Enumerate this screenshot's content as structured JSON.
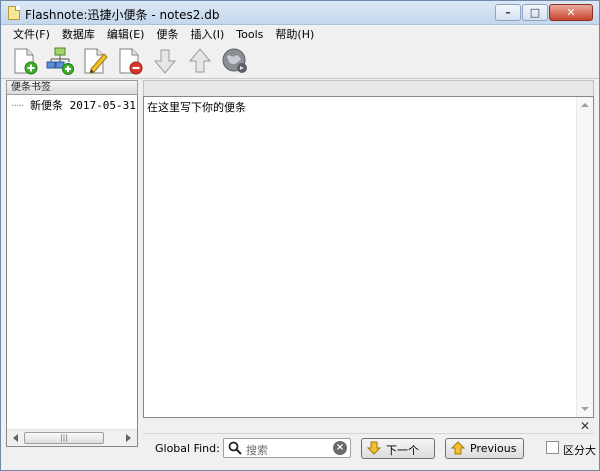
{
  "window": {
    "title": "Flashnote:迅捷小便条 - notes2.db",
    "caption": {
      "minimize": "–",
      "maximize": "□",
      "close": "✕"
    }
  },
  "menu": {
    "items": [
      {
        "label": "文件(F)"
      },
      {
        "label": "数据库"
      },
      {
        "label": "编辑(E)"
      },
      {
        "label": "便条"
      },
      {
        "label": "插入(I)"
      },
      {
        "label": "Tools"
      },
      {
        "label": "帮助(H)"
      }
    ]
  },
  "toolbar": {
    "buttons": [
      {
        "icon": "new-note-icon"
      },
      {
        "icon": "new-database-icon"
      },
      {
        "icon": "edit-note-icon"
      },
      {
        "icon": "delete-note-icon"
      },
      {
        "icon": "move-down-icon"
      },
      {
        "icon": "move-up-icon"
      },
      {
        "icon": "globe-icon"
      }
    ]
  },
  "sidebar": {
    "header": "便条书签",
    "tree": [
      {
        "label": "新便条 2017-05-31"
      }
    ],
    "scroll_thumb_glyph": "|||"
  },
  "editor": {
    "content": "在这里写下你的便条"
  },
  "findbar": {
    "close_glyph": "✕",
    "label": "Global Find:",
    "placeholder": "搜索",
    "next_label": "下一个",
    "prev_label": "Previous",
    "case_label": "区分大"
  },
  "colors": {
    "titlebar": "#c5d7ec",
    "close_button": "#c7442e",
    "arrow_yellow": "#f2c12e"
  }
}
